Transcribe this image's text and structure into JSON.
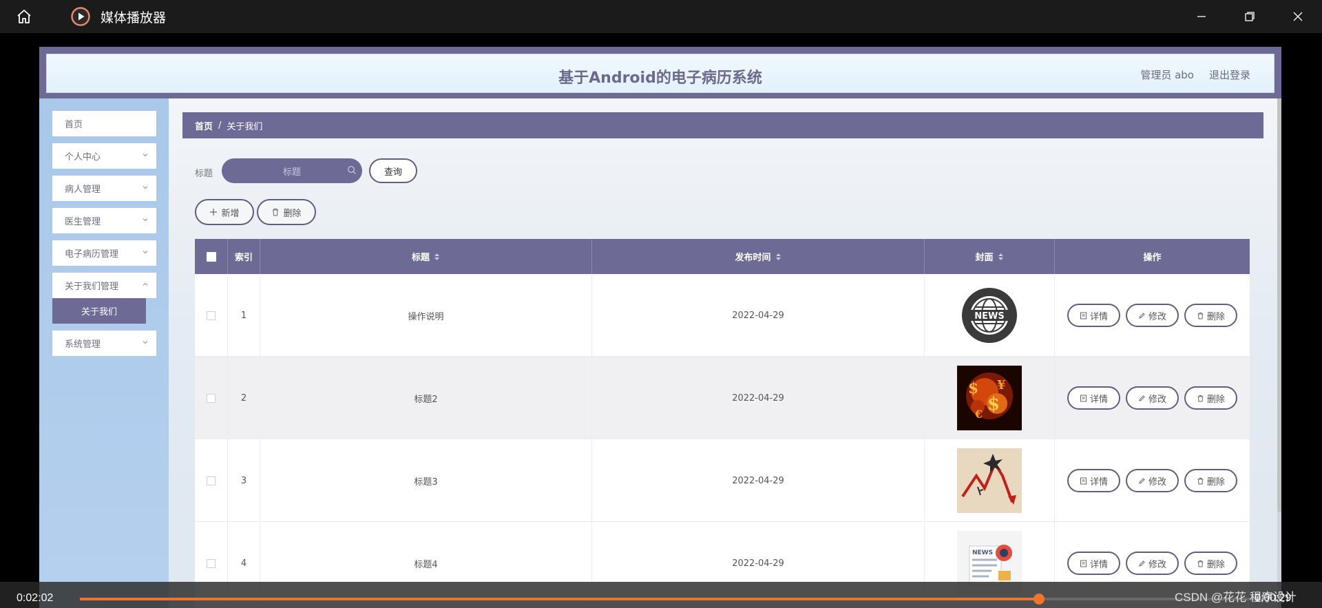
{
  "player": {
    "title": "媒体播放器",
    "time_elapsed": "0:02:02",
    "time_remaining": "0:00:29",
    "progress": 0.81,
    "watermark": "CSDN @花花 程序设计"
  },
  "app": {
    "title": "基于Android的电子病历系统",
    "user": "管理员 abo",
    "logout": "退出登录"
  },
  "sidebar": {
    "items": [
      {
        "label": "首页"
      },
      {
        "label": "个人中心"
      },
      {
        "label": "病人管理"
      },
      {
        "label": "医生管理"
      },
      {
        "label": "电子病历管理"
      },
      {
        "label": "关于我们管理"
      },
      {
        "label": "系统管理"
      }
    ],
    "active_sub": "关于我们"
  },
  "breadcrumb": {
    "home": "首页",
    "separator": "/",
    "current": "关于我们"
  },
  "search": {
    "label": "标题",
    "placeholder": "标题",
    "query_button": "查询"
  },
  "actions": {
    "add": "新增",
    "delete": "删除"
  },
  "table": {
    "headers": {
      "index": "索引",
      "title": "标题",
      "publish_time": "发布时间",
      "cover": "封面",
      "operation": "操作"
    },
    "row_actions": {
      "detail": "详情",
      "edit": "修改",
      "delete": "删除"
    },
    "rows": [
      {
        "index": "1",
        "title": "操作说明",
        "publish_time": "2022-04-29",
        "cover": "news-globe-image"
      },
      {
        "index": "2",
        "title": "标题2",
        "publish_time": "2022-04-29",
        "cover": "fire-letters-image"
      },
      {
        "index": "3",
        "title": "标题3",
        "publish_time": "2022-04-29",
        "cover": "falling-chart-image"
      },
      {
        "index": "4",
        "title": "标题4",
        "publish_time": "2022-04-29",
        "cover": "news-paper-image"
      }
    ]
  },
  "colors": {
    "accent": "#6d6a96",
    "progress": "#f0742e"
  }
}
